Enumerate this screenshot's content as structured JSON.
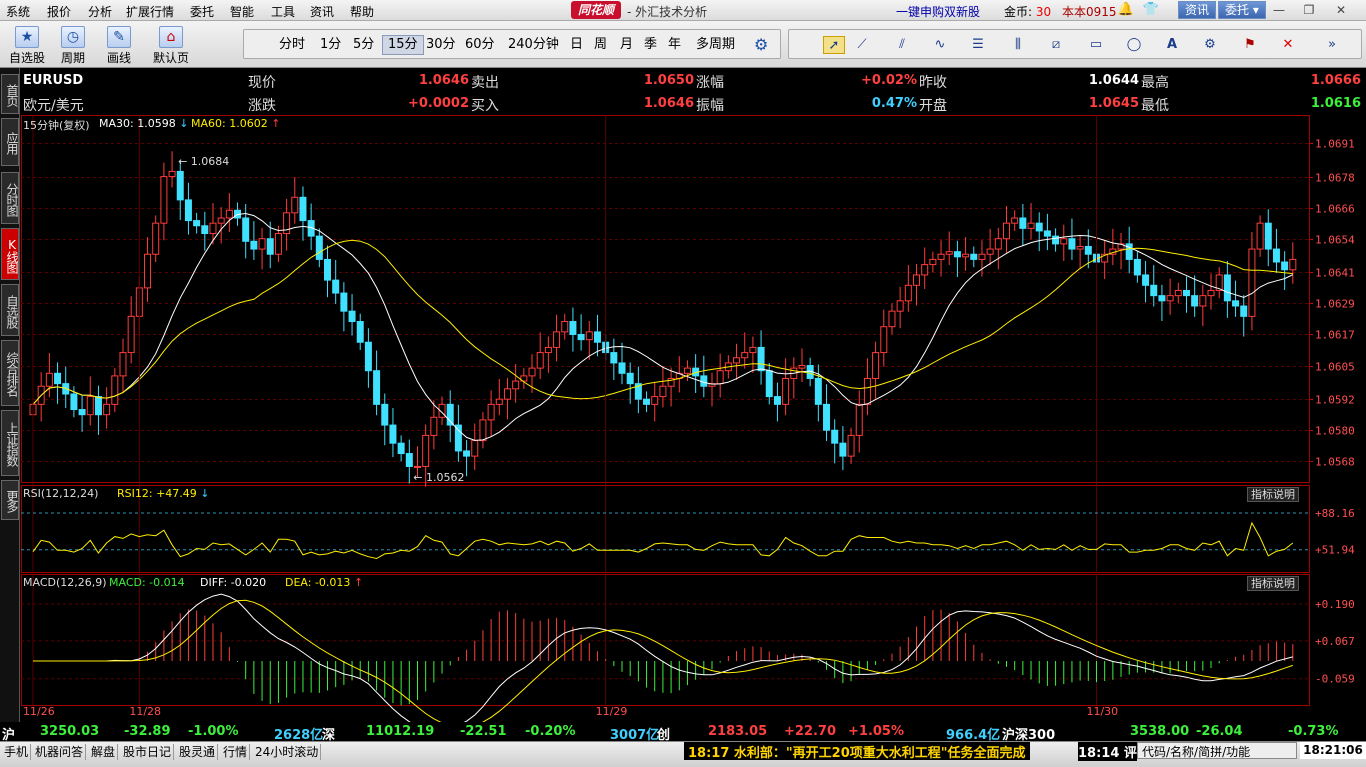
{
  "menu": [
    "系统",
    "报价",
    "分析",
    "扩展行情",
    "委托",
    "智能",
    "工具",
    "资讯",
    "帮助"
  ],
  "brand": "同花顺",
  "app_title": "- 外汇技术分析",
  "promo": "一键申购双新股",
  "coins_label": "金币:",
  "coins_value": "30",
  "user": "本本0915",
  "top_buttons": {
    "news": "资讯",
    "trade": "委托"
  },
  "window_buttons": [
    "—",
    "❐",
    "✕"
  ],
  "tools": [
    {
      "label": "自选股",
      "icon": "star-icon"
    },
    {
      "label": "周期",
      "icon": "clock-icon"
    },
    {
      "label": "画线",
      "icon": "pencil-icon"
    },
    {
      "label": "默认页",
      "icon": "home-icon"
    }
  ],
  "periods": [
    "分时",
    "1分",
    "5分",
    "15分",
    "30分",
    "60分",
    "240分钟",
    "日",
    "周",
    "月",
    "季",
    "年",
    "多周期"
  ],
  "active_period": "15分",
  "sidebar_tabs": [
    "首页",
    "应用",
    "分时图",
    "K线图",
    "自选股",
    "综合排名",
    "上证指数",
    "更多"
  ],
  "active_sidebar": "K线图",
  "quote": {
    "symbol": "EURUSD",
    "name": "欧元/美元",
    "fields": [
      {
        "label": "现价",
        "value": "1.0646",
        "color": "red"
      },
      {
        "label": "卖出",
        "value": "1.0650",
        "color": "red"
      },
      {
        "label": "涨幅",
        "value": "+0.02%",
        "color": "red"
      },
      {
        "label": "昨收",
        "value": "1.0644",
        "color": "white"
      },
      {
        "label": "最高",
        "value": "1.0666",
        "color": "red"
      },
      {
        "label": "涨跌",
        "value": "+0.0002",
        "color": "red"
      },
      {
        "label": "买入",
        "value": "1.0646",
        "color": "red"
      },
      {
        "label": "振幅",
        "value": "0.47%",
        "color": "cyan"
      },
      {
        "label": "开盘",
        "value": "1.0645",
        "color": "red"
      },
      {
        "label": "最低",
        "value": "1.0616",
        "color": "green"
      }
    ]
  },
  "main_header": {
    "period": "15分钟(复权)",
    "ma30": "MA30: 1.0598",
    "ma30_arrow": "↓",
    "ma60": "MA60: 1.0602",
    "ma60_arrow": "↑"
  },
  "rsi_header": {
    "name": "RSI(12,12,24)",
    "value": "RSI12: +47.49",
    "arrow": "↓",
    "button": "指标说明"
  },
  "macd_header": {
    "name": "MACD(12,26,9)",
    "macd": "MACD: -0.014",
    "diff": "DIFF: -0.020",
    "dea": "DEA: -0.013",
    "arrow": "↑",
    "button": "指标说明"
  },
  "chart_data": [
    {
      "type": "candlestick",
      "title": "EURUSD 15分钟(复权)",
      "y_ticks": [
        "1.0691",
        "1.0678",
        "1.0666",
        "1.0654",
        "1.0641",
        "1.0629",
        "1.0617",
        "1.0605",
        "1.0592",
        "1.0580",
        "1.0568"
      ],
      "ylim": [
        1.056,
        1.0696
      ],
      "x_ticks": [
        "11/26",
        "11/28",
        "11/29",
        "11/30"
      ],
      "annotations": [
        {
          "text": "1.0684",
          "type": "high"
        },
        {
          "text": "1.0562",
          "type": "low"
        }
      ],
      "series": [
        {
          "name": "MA30",
          "last": 1.0598
        },
        {
          "name": "MA60",
          "last": 1.0602
        }
      ],
      "close": [
        1.059,
        1.0597,
        1.0602,
        1.0598,
        1.0594,
        1.0588,
        1.0586,
        1.0593,
        1.0586,
        1.059,
        1.0601,
        1.061,
        1.0624,
        1.0635,
        1.0648,
        1.066,
        1.0678,
        1.068,
        1.0669,
        1.0661,
        1.0659,
        1.0656,
        1.066,
        1.0662,
        1.0665,
        1.0662,
        1.0653,
        1.065,
        1.0654,
        1.0648,
        1.0656,
        1.0664,
        1.067,
        1.0661,
        1.0655,
        1.0646,
        1.0638,
        1.0633,
        1.0626,
        1.0622,
        1.0614,
        1.0603,
        1.059,
        1.0582,
        1.0575,
        1.0571,
        1.0566,
        1.0566,
        1.0578,
        1.0585,
        1.059,
        1.0582,
        1.0572,
        1.057,
        1.0576,
        1.0584,
        1.059,
        1.0592,
        1.0596,
        1.0599,
        1.0601,
        1.0604,
        1.061,
        1.0612,
        1.0618,
        1.0622,
        1.0617,
        1.0615,
        1.0618,
        1.0614,
        1.061,
        1.0606,
        1.0602,
        1.0598,
        1.0592,
        1.059,
        1.0593,
        1.0597,
        1.06,
        1.0602,
        1.0604,
        1.0601,
        1.0597,
        1.0598,
        1.0603,
        1.0606,
        1.0608,
        1.061,
        1.0612,
        1.0603,
        1.0593,
        1.059,
        1.06,
        1.0604,
        1.0605,
        1.06,
        1.059,
        1.058,
        1.0575,
        1.057,
        1.0578,
        1.059,
        1.06,
        1.061,
        1.062,
        1.0626,
        1.063,
        1.0636,
        1.064,
        1.0644,
        1.0646,
        1.0648,
        1.0649,
        1.0647,
        1.0648,
        1.0646,
        1.0648,
        1.065,
        1.0654,
        1.066,
        1.0662,
        1.0658,
        1.066,
        1.0657,
        1.0655,
        1.0652,
        1.0654,
        1.065,
        1.0651,
        1.0648,
        1.0645,
        1.0648,
        1.065,
        1.0652,
        1.0646,
        1.064,
        1.0636,
        1.0632,
        1.063,
        1.0632,
        1.0634,
        1.0632,
        1.0628,
        1.0632,
        1.0634,
        1.064,
        1.063,
        1.0628,
        1.0624,
        1.065,
        1.066,
        1.065,
        1.0645,
        1.0642,
        1.0646
      ],
      "rsi": {
        "name": "RSI12",
        "last": 47.49,
        "y_ticks": [
          "+88.16",
          "+51.94"
        ],
        "ylim": [
          30,
          100
        ]
      },
      "macd": {
        "name": "MACD",
        "macd": -0.014,
        "diff": -0.02,
        "dea": -0.013,
        "y_ticks": [
          "+0.190",
          "+0.067",
          "-0.059"
        ],
        "ylim": [
          -0.14,
          0.24
        ]
      }
    }
  ],
  "status": {
    "sh": {
      "label": "沪",
      "value": "3250.03",
      "change": "-32.89",
      "pct": "-1.00%",
      "vol": "2628亿"
    },
    "sz": {
      "label": "深",
      "value": "11012.19",
      "change": "-22.51",
      "pct": "-0.20%",
      "vol": "3007亿"
    },
    "cy": {
      "label": "创",
      "value": "2183.05",
      "change": "+22.70",
      "pct": "+1.05%",
      "vol": "966.4亿"
    },
    "hs300": {
      "label": "沪深300",
      "value": "3538.00",
      "change": "-26.04",
      "pct": "-0.73%"
    }
  },
  "bottom_tabs": [
    "手机",
    "机器问答",
    "解盘",
    "股市日记",
    "股灵通",
    "行情",
    "24小时滚动"
  ],
  "ticker": "18:17 水利部：\"再开工20项重大水利工程\"任务全面完成",
  "ticker2": "18:14 评",
  "search_placeholder": "代码/名称/简拼/功能",
  "clock": "18:21:06"
}
